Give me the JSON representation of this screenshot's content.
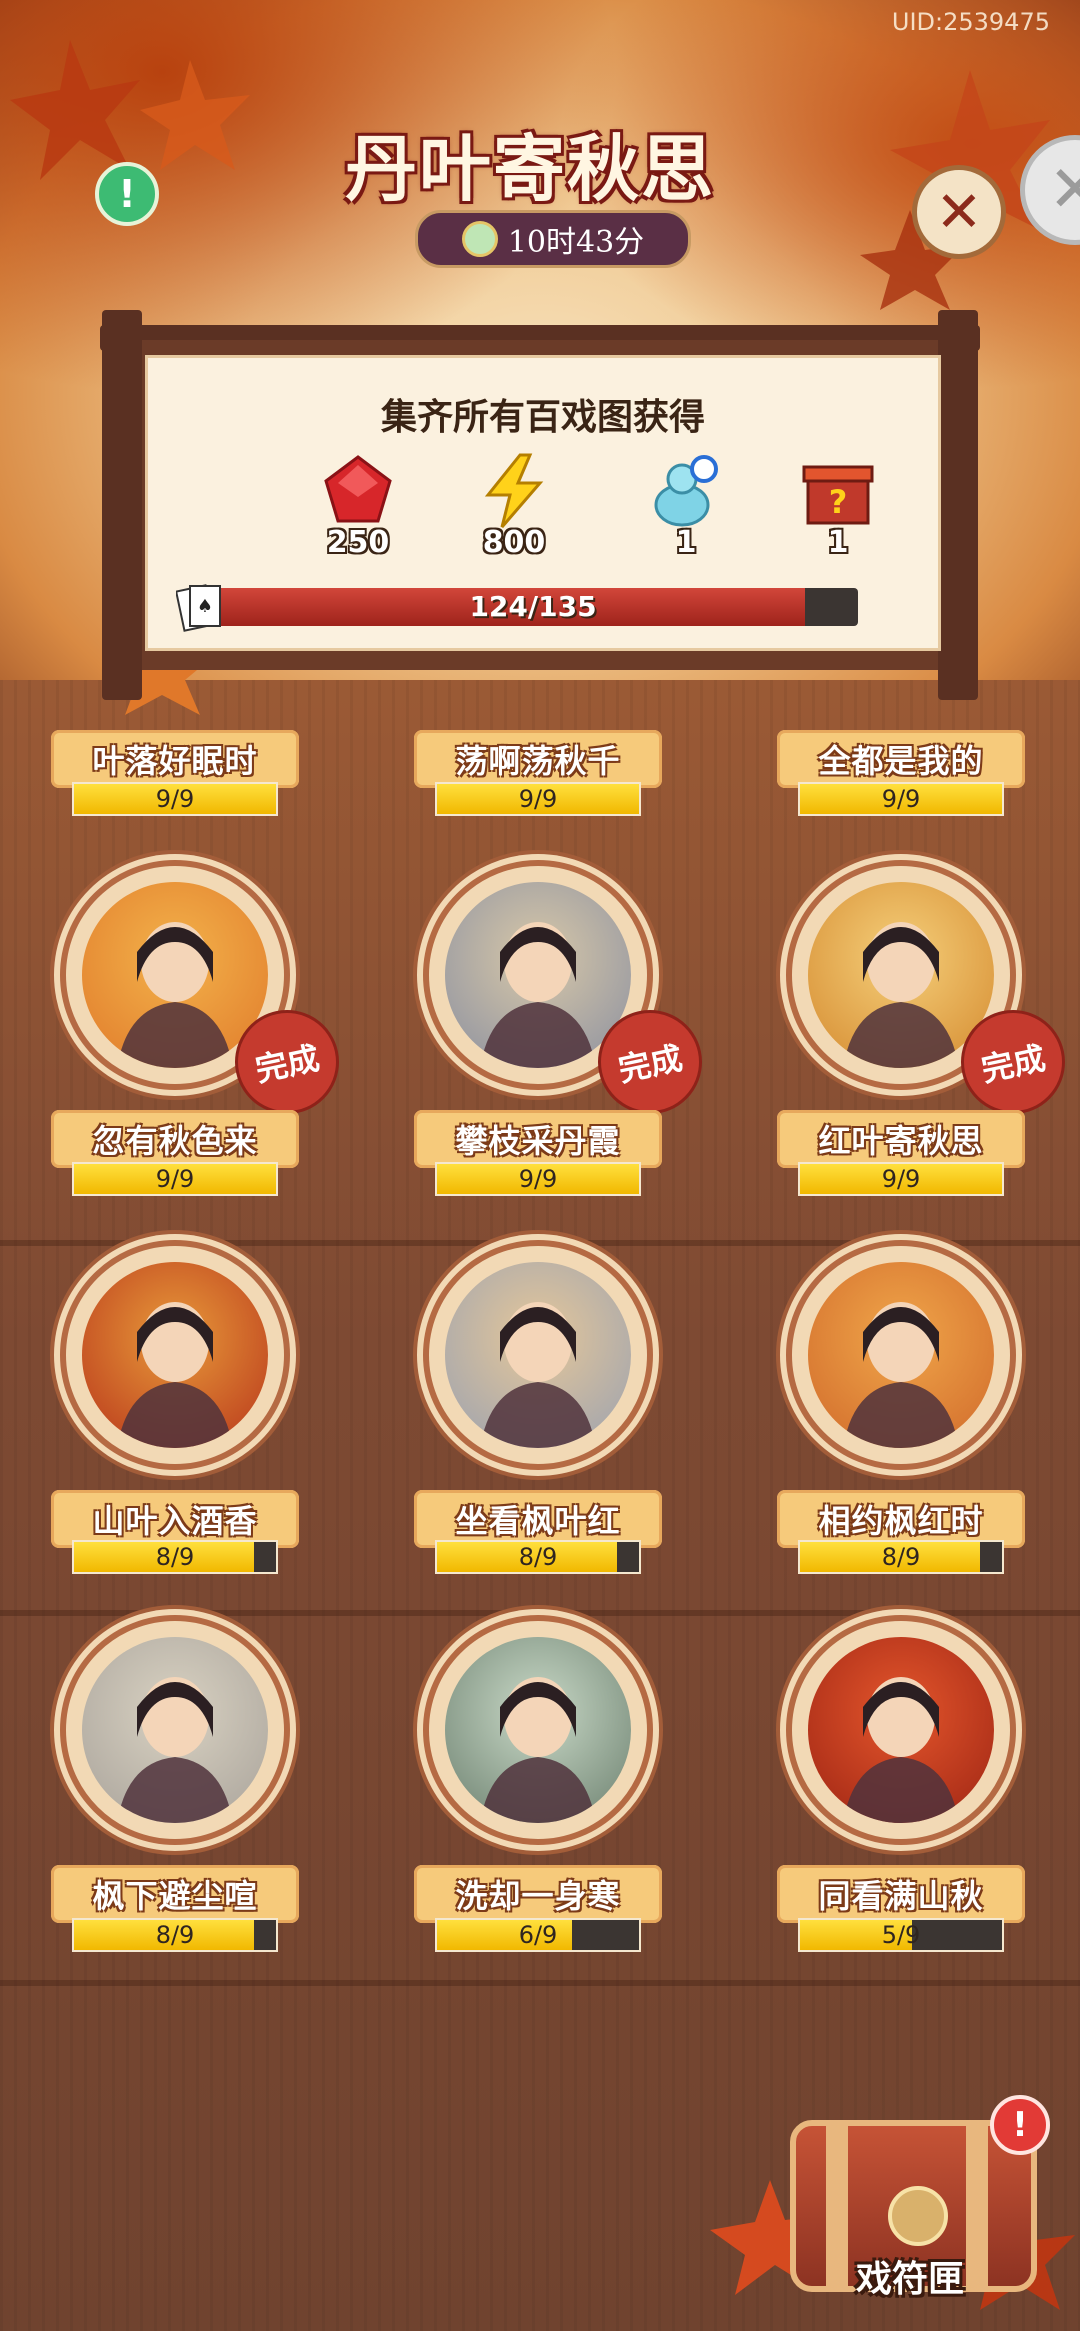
{
  "uid": "UID:2539475",
  "title": "丹叶寄秋思",
  "timer": "10时43分",
  "panel": {
    "heading": "集齐所有百戏图获得",
    "rewards": [
      {
        "icon": "red-gem-icon",
        "count": "250"
      },
      {
        "icon": "lightning-icon",
        "count": "800"
      },
      {
        "icon": "gourd-magnifier-icon",
        "count": "1"
      },
      {
        "icon": "mystery-box-icon",
        "count": "1"
      }
    ],
    "progress_text": "124/135",
    "progress": 0.9185
  },
  "cards": [
    {
      "name": "叶落好眠时",
      "count": "9/9",
      "fill": 1.0
    },
    {
      "name": "荡啊荡秋千",
      "count": "9/9",
      "fill": 1.0
    },
    {
      "name": "全都是我的",
      "count": "9/9",
      "fill": 1.0
    },
    {
      "name": "忽有秋色来",
      "count": "9/9",
      "fill": 1.0,
      "badge": "完成"
    },
    {
      "name": "攀枝采丹霞",
      "count": "9/9",
      "fill": 1.0,
      "badge": "完成"
    },
    {
      "name": "红叶寄秋思",
      "count": "9/9",
      "fill": 1.0,
      "badge": "完成"
    },
    {
      "name": "山叶入酒香",
      "count": "8/9",
      "fill": 0.889
    },
    {
      "name": "坐看枫叶红",
      "count": "8/9",
      "fill": 0.889
    },
    {
      "name": "相约枫红时",
      "count": "8/9",
      "fill": 0.889
    },
    {
      "name": "枫下避尘喧",
      "count": "8/9",
      "fill": 0.889
    },
    {
      "name": "洗却一身寒",
      "count": "6/9",
      "fill": 0.667
    },
    {
      "name": "同看满山秋",
      "count": "5/9",
      "fill": 0.556
    }
  ],
  "chest": {
    "label": "戏符匣"
  },
  "colors": {
    "accent": "#c53a2e",
    "bar_fill": "#ffd21a",
    "plate": "#f6ca7b"
  }
}
